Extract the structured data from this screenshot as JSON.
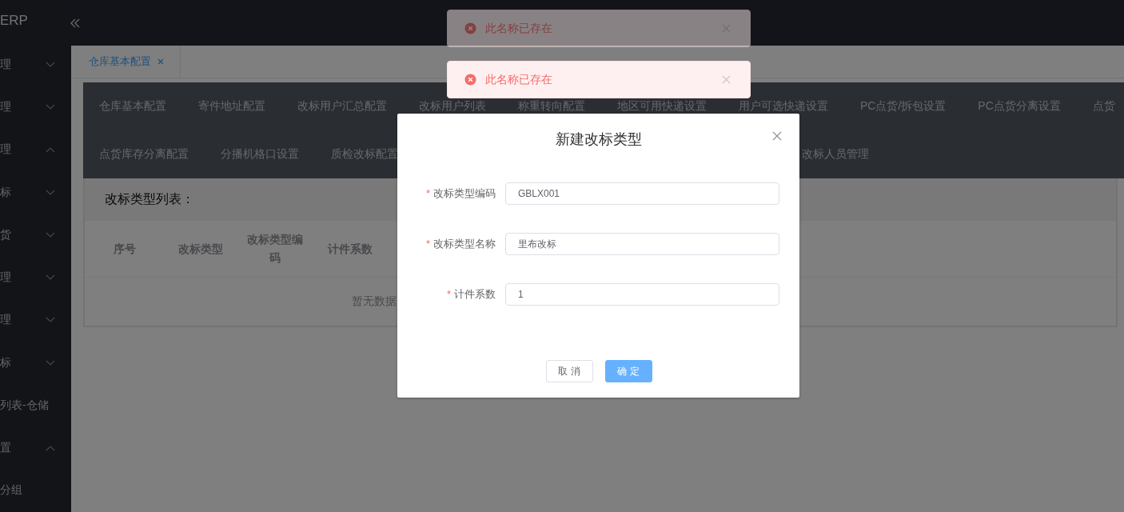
{
  "app": {
    "logo": "ERP"
  },
  "sidebar": {
    "items": [
      {
        "label": "理",
        "expanded": false
      },
      {
        "label": "理",
        "expanded": false
      },
      {
        "label": "理",
        "expanded": true
      },
      {
        "label": "标",
        "expanded": false
      },
      {
        "label": "货",
        "expanded": false
      },
      {
        "label": "理",
        "expanded": false
      },
      {
        "label": "理",
        "expanded": false
      },
      {
        "label": "标",
        "expanded": false
      },
      {
        "label": "列表-仓储"
      },
      {
        "label": "置",
        "expanded": true
      },
      {
        "label": "分组"
      }
    ]
  },
  "page_tabs": [
    {
      "label": "仓库基本配置",
      "selected": true
    }
  ],
  "nav_menu": [
    [
      "仓库基本配置",
      "寄件地址配置",
      "改标用户汇总配置",
      "改标用户列表",
      "称重转向配置",
      "地区可用快递设置",
      "用户可选快递设置",
      "PC点货/拆包设置",
      "PC点货分离设置",
      "点货"
    ],
    [
      "点货库存分离配置",
      "分播机格口设置",
      "质检改标配置",
      "改标人员管理"
    ]
  ],
  "list_panel": {
    "title": "改标类型列表：",
    "columns": [
      "序号",
      "改标类型",
      "改标类型编码",
      "计件系数"
    ],
    "empty_text": "暂无数据"
  },
  "toasts": [
    {
      "message": "此名称已存在",
      "fading": true
    },
    {
      "message": "此名称已存在",
      "fading": false
    }
  ],
  "dialog": {
    "title": "新建改标类型",
    "fields": [
      {
        "label": "改标类型编码",
        "required_mark": "*",
        "value": "GBLX001"
      },
      {
        "label": "改标类型名称",
        "required_mark": "*",
        "value": "里布改标"
      },
      {
        "label": "计件系数",
        "required_mark": "*",
        "value": "1"
      }
    ],
    "buttons": [
      {
        "label": "取 消",
        "kind": "default"
      },
      {
        "label": "确 定",
        "kind": "primary"
      }
    ]
  }
}
